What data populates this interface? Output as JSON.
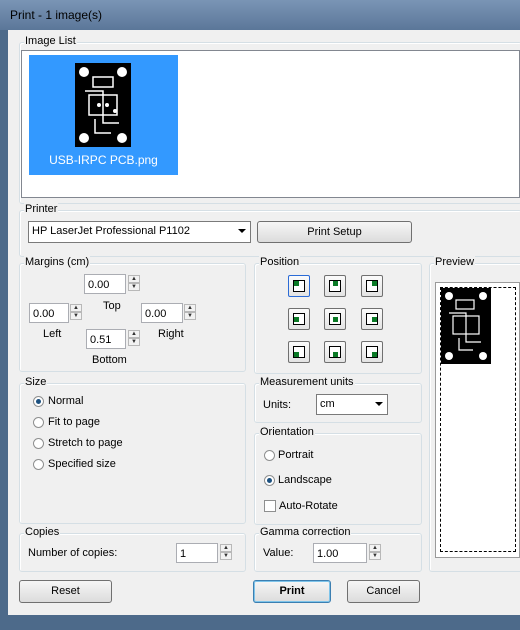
{
  "window": {
    "title": "Print  -  1 image(s)"
  },
  "image_list": {
    "label": "Image List",
    "items": [
      {
        "filename": "USB-IRPC PCB.png",
        "selected": true
      }
    ]
  },
  "printer": {
    "label": "Printer",
    "selected": "HP LaserJet Professional P1102",
    "setup_label": "Print Setup"
  },
  "margins": {
    "label": "Margins (cm)",
    "top": "0.00",
    "left": "0.00",
    "right": "0.00",
    "bottom": "0.51",
    "top_label": "Top",
    "left_label": "Left",
    "right_label": "Right",
    "bottom_label": "Bottom"
  },
  "position": {
    "label": "Position",
    "selected": "top-left"
  },
  "preview": {
    "label": "Preview"
  },
  "size": {
    "label": "Size",
    "options": [
      "Normal",
      "Fit to page",
      "Stretch to page",
      "Specified size"
    ],
    "selected": "Normal"
  },
  "measurement": {
    "label": "Measurement units",
    "units_label": "Units:",
    "units": "cm"
  },
  "orientation": {
    "label": "Orientation",
    "options": [
      "Portrait",
      "Landscape"
    ],
    "selected": "Landscape",
    "auto_rotate_label": "Auto-Rotate",
    "auto_rotate": false
  },
  "copies": {
    "label": "Copies",
    "count_label": "Number of copies:",
    "count": "1"
  },
  "gamma": {
    "label": "Gamma correction",
    "value_label": "Value:",
    "value": "1.00"
  },
  "buttons": {
    "reset": "Reset",
    "print": "Print",
    "cancel": "Cancel"
  },
  "colors": {
    "selection": "#3399ff",
    "accent": "#0a7a26"
  }
}
